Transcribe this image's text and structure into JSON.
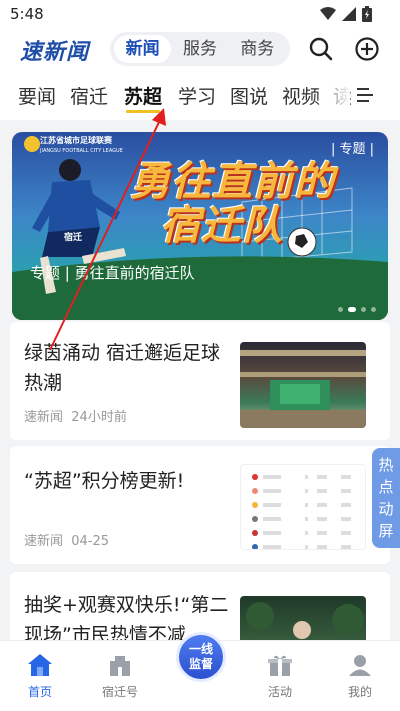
{
  "status": {
    "time": "5:48"
  },
  "header": {
    "logo": "速新闻",
    "segments": [
      "新闻",
      "服务",
      "商务"
    ],
    "active_segment": "新闻"
  },
  "tabs": [
    "要闻",
    "宿迁",
    "苏超",
    "学习",
    "图说",
    "视频",
    "读"
  ],
  "active_tab": "苏超",
  "banner": {
    "tag": "| 专题 |",
    "league_line1": "江苏省城市足球联赛",
    "league_line2": "JIANGSU FOOTBALL CITY LEAGUE",
    "headline_line1": "勇往直前的",
    "headline_line2": "宿迁队",
    "jersey": "宿迁",
    "caption": "专题 | 勇往直前的宿迁队"
  },
  "articles": [
    {
      "title": "绿茵涌动 宿迁邂逅足球热潮",
      "source": "速新闻",
      "time": "24小时前"
    },
    {
      "title": "“苏超”积分榜更新!",
      "source": "速新闻",
      "time": "04-25"
    },
    {
      "title": "抽奖+观赛双快乐!“第二现场”市民热情不减"
    }
  ],
  "float_label": "热点动屏",
  "nav": {
    "home": "首页",
    "suqian": "宿迁号",
    "center_line1": "一线",
    "center_line2": "监督",
    "activity": "活动",
    "mine": "我的"
  },
  "colors": {
    "brand": "#1b4fb5",
    "accent_underline": "#f0c020",
    "nav_active": "#2766e4",
    "annotation_arrow": "#e02020"
  }
}
